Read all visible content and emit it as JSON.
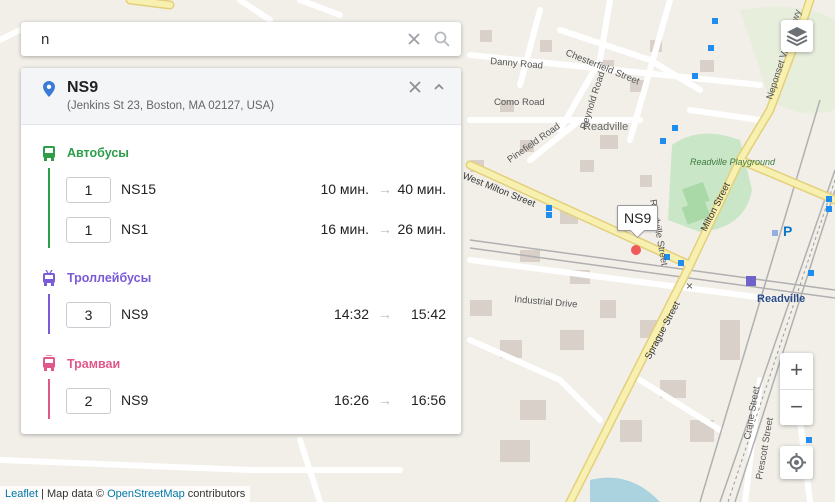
{
  "search": {
    "value": "n"
  },
  "stop": {
    "name": "NS9",
    "address": "(Jenkins St 23, Boston, MA 02127, USA)",
    "marker_label": "NS9"
  },
  "groups": [
    {
      "title": "Автобусы",
      "color": "#2e9d4a",
      "icon": "bus-icon",
      "routes": [
        {
          "num": "1",
          "name": "NS15",
          "from": "10 мин.",
          "to": "40 мин."
        },
        {
          "num": "1",
          "name": "NS1",
          "from": "16 мин.",
          "to": "26 мин."
        }
      ]
    },
    {
      "title": "Троллейбусы",
      "color": "#7a5bd6",
      "icon": "trolleybus-icon",
      "routes": [
        {
          "num": "3",
          "name": "NS9",
          "from": "14:32",
          "to": "15:42"
        }
      ]
    },
    {
      "title": "Трамваи",
      "color": "#e0578a",
      "icon": "tram-icon",
      "routes": [
        {
          "num": "2",
          "name": "NS9",
          "from": "16:26",
          "to": "16:56"
        }
      ]
    }
  ],
  "map_labels": {
    "danny_road": "Danny Road",
    "como_road": "Como Road",
    "pinefield_road": "Pinefield Road",
    "readville": "Readville",
    "readville_playground": "Readville Playground",
    "milton_street": "Milton Street",
    "west_milton_street": "West Milton Street",
    "industrial_drive": "Industrial Drive",
    "sprague_street": "Sprague Street",
    "readville_station": "Readville",
    "chesterfield_street": "Chesterfield Street",
    "reynold_road": "Reynold Road",
    "neponset_valley": "Neponset Valley Pkwy",
    "prescott_street": "Prescott Street",
    "crane_street": "Crane Street",
    "readville_road": "Readville Street"
  },
  "zoom": {
    "in": "+",
    "out": "−"
  },
  "attribution": {
    "leaflet": "Leaflet",
    "sep": " | Map data © ",
    "osm": "OpenStreetMap",
    "rest": " contributors"
  },
  "colors": {
    "accent": "#3a7bd5",
    "marker": "#f05a5a"
  }
}
